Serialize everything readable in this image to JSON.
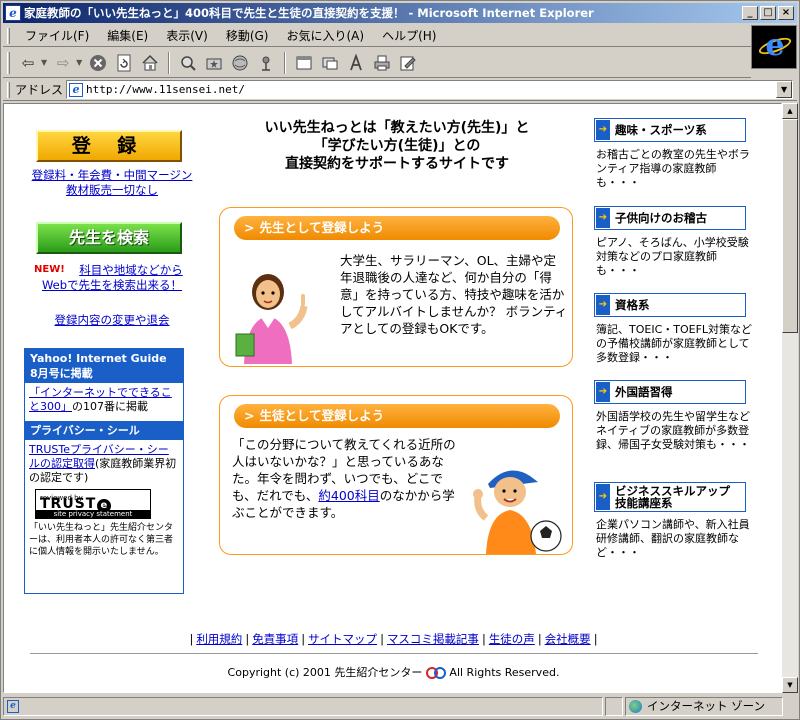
{
  "window": {
    "title": "家庭教師の「いい先生ねっと」400科目で先生と生徒の直接契約を支援！ - Microsoft Internet Explorer",
    "min_btn": "_",
    "max_btn": "□",
    "close_btn": "×"
  },
  "menubar": {
    "items": [
      "ファイル(F)",
      "編集(E)",
      "表示(V)",
      "移動(G)",
      "お気に入り(A)",
      "ヘルプ(H)"
    ]
  },
  "address": {
    "label": "アドレス",
    "url": "http://www.11sensei.net/"
  },
  "status": {
    "zone": "インターネット ゾーン"
  },
  "left": {
    "register_label": "登 録",
    "register_note_1": "登録料・年会費・中間マージン",
    "register_note_2": "教材販売一切なし",
    "search_label": "先生を検索",
    "new_label": "NEW!",
    "search_note_1": "科目や地域などから",
    "search_note_2": "Webで先生を検索出来る！",
    "change_link": "登録内容の変更や退会",
    "yahoo_head": "Yahoo! Internet Guide 8月号に掲載",
    "yahoo_link": "「インターネットでできること300」",
    "yahoo_text": "の107番に掲載",
    "privacy_head": "プライバシー・シール",
    "privacy_link": "TRUSTeプライバシー・シールの認定取得",
    "privacy_text": "(家庭教師業界初の認定です)",
    "trust_small": "reviewed by",
    "trust_big": "TRUST",
    "trust_e": "e",
    "trust_bottom": "site privacy statement",
    "privacy_note": "「いい先生ねっと」先生紹介センターは、利用者本人の許可なく第三者に個人情報を開示いたしません。"
  },
  "center": {
    "intro_1": "いい先生ねっとは「教えたい方(先生)」と",
    "intro_2": "「学びたい方(生徒)」との",
    "intro_3": "直接契約をサポートするサイトです",
    "teacher_head": "先生として登録しよう",
    "teacher_text": "大学生、サラリーマン、OL、主婦や定年退職後の人達など、何か自分の「得意」を持っている方、特技や趣味を活かしてアルバイトしませんか？ ボランティアとしての登録もOKです。",
    "student_head": "生徒として登録しよう",
    "student_text_1": "「この分野について教えてくれる近所の人はいないかな？」と思っているあなた。年令を問わず、いつでも、どこでも、だれでも、",
    "student_link": "約400科目",
    "student_text_2": "のなかから学ぶことができます。"
  },
  "right": {
    "cats": [
      {
        "label": "趣味・スポーツ系",
        "desc": "お稽古ごとの教室の先生やボランティア指導の家庭教師も・・・"
      },
      {
        "label": "子供向けのお稽古",
        "desc": "ピアノ、そろばん、小学校受験対策などのプロ家庭教師も・・・"
      },
      {
        "label": "資格系",
        "desc": "簿記、TOEIC・TOEFL対策などの予備校講師が家庭教師として多数登録・・・"
      },
      {
        "label": "外国語習得",
        "desc": "外国語学校の先生や留学生などネイティブの家庭教師が多数登録、帰国子女受験対策も・・・"
      },
      {
        "label": "ビジネススキルアップ技能講座系",
        "desc": "企業パソコン講師や、新入社員研修講師、翻訳の家庭教師など・・・"
      }
    ]
  },
  "footer": {
    "links": [
      "利用規約",
      "免責事項",
      "サイトマップ",
      "マスコミ掲載記事",
      "生徒の声",
      "会社概要"
    ],
    "copyright_pre": "Copyright (c) 2001 先生紹介センター",
    "copyright_post": "All Rights Reserved."
  },
  "icons": {
    "back": "back-arrow-icon",
    "forward": "forward-arrow-icon",
    "stop": "stop-icon",
    "refresh": "refresh-icon",
    "home": "home-icon",
    "search": "search-icon",
    "favorites": "favorites-icon",
    "history": "history-icon",
    "channels": "channels-icon",
    "fullscreen": "fullscreen-icon",
    "mail": "mail-icon",
    "font": "font-icon",
    "print": "print-icon",
    "edit": "edit-icon"
  },
  "colors": {
    "accent_blue": "#1a5fc8",
    "orange": "#f08a00",
    "link": "#0000cc"
  }
}
